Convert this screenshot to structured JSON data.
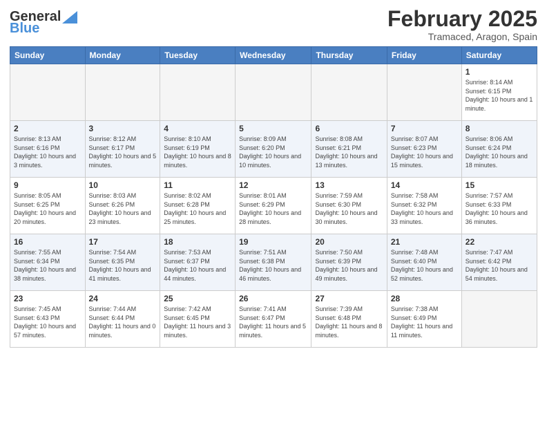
{
  "logo": {
    "general": "General",
    "blue": "Blue"
  },
  "header": {
    "month": "February 2025",
    "location": "Tramaced, Aragon, Spain"
  },
  "days_of_week": [
    "Sunday",
    "Monday",
    "Tuesday",
    "Wednesday",
    "Thursday",
    "Friday",
    "Saturday"
  ],
  "weeks": [
    [
      {
        "day": "",
        "info": ""
      },
      {
        "day": "",
        "info": ""
      },
      {
        "day": "",
        "info": ""
      },
      {
        "day": "",
        "info": ""
      },
      {
        "day": "",
        "info": ""
      },
      {
        "day": "",
        "info": ""
      },
      {
        "day": "1",
        "info": "Sunrise: 8:14 AM\nSunset: 6:15 PM\nDaylight: 10 hours and 1 minute."
      }
    ],
    [
      {
        "day": "2",
        "info": "Sunrise: 8:13 AM\nSunset: 6:16 PM\nDaylight: 10 hours and 3 minutes."
      },
      {
        "day": "3",
        "info": "Sunrise: 8:12 AM\nSunset: 6:17 PM\nDaylight: 10 hours and 5 minutes."
      },
      {
        "day": "4",
        "info": "Sunrise: 8:10 AM\nSunset: 6:19 PM\nDaylight: 10 hours and 8 minutes."
      },
      {
        "day": "5",
        "info": "Sunrise: 8:09 AM\nSunset: 6:20 PM\nDaylight: 10 hours and 10 minutes."
      },
      {
        "day": "6",
        "info": "Sunrise: 8:08 AM\nSunset: 6:21 PM\nDaylight: 10 hours and 13 minutes."
      },
      {
        "day": "7",
        "info": "Sunrise: 8:07 AM\nSunset: 6:23 PM\nDaylight: 10 hours and 15 minutes."
      },
      {
        "day": "8",
        "info": "Sunrise: 8:06 AM\nSunset: 6:24 PM\nDaylight: 10 hours and 18 minutes."
      }
    ],
    [
      {
        "day": "9",
        "info": "Sunrise: 8:05 AM\nSunset: 6:25 PM\nDaylight: 10 hours and 20 minutes."
      },
      {
        "day": "10",
        "info": "Sunrise: 8:03 AM\nSunset: 6:26 PM\nDaylight: 10 hours and 23 minutes."
      },
      {
        "day": "11",
        "info": "Sunrise: 8:02 AM\nSunset: 6:28 PM\nDaylight: 10 hours and 25 minutes."
      },
      {
        "day": "12",
        "info": "Sunrise: 8:01 AM\nSunset: 6:29 PM\nDaylight: 10 hours and 28 minutes."
      },
      {
        "day": "13",
        "info": "Sunrise: 7:59 AM\nSunset: 6:30 PM\nDaylight: 10 hours and 30 minutes."
      },
      {
        "day": "14",
        "info": "Sunrise: 7:58 AM\nSunset: 6:32 PM\nDaylight: 10 hours and 33 minutes."
      },
      {
        "day": "15",
        "info": "Sunrise: 7:57 AM\nSunset: 6:33 PM\nDaylight: 10 hours and 36 minutes."
      }
    ],
    [
      {
        "day": "16",
        "info": "Sunrise: 7:55 AM\nSunset: 6:34 PM\nDaylight: 10 hours and 38 minutes."
      },
      {
        "day": "17",
        "info": "Sunrise: 7:54 AM\nSunset: 6:35 PM\nDaylight: 10 hours and 41 minutes."
      },
      {
        "day": "18",
        "info": "Sunrise: 7:53 AM\nSunset: 6:37 PM\nDaylight: 10 hours and 44 minutes."
      },
      {
        "day": "19",
        "info": "Sunrise: 7:51 AM\nSunset: 6:38 PM\nDaylight: 10 hours and 46 minutes."
      },
      {
        "day": "20",
        "info": "Sunrise: 7:50 AM\nSunset: 6:39 PM\nDaylight: 10 hours and 49 minutes."
      },
      {
        "day": "21",
        "info": "Sunrise: 7:48 AM\nSunset: 6:40 PM\nDaylight: 10 hours and 52 minutes."
      },
      {
        "day": "22",
        "info": "Sunrise: 7:47 AM\nSunset: 6:42 PM\nDaylight: 10 hours and 54 minutes."
      }
    ],
    [
      {
        "day": "23",
        "info": "Sunrise: 7:45 AM\nSunset: 6:43 PM\nDaylight: 10 hours and 57 minutes."
      },
      {
        "day": "24",
        "info": "Sunrise: 7:44 AM\nSunset: 6:44 PM\nDaylight: 11 hours and 0 minutes."
      },
      {
        "day": "25",
        "info": "Sunrise: 7:42 AM\nSunset: 6:45 PM\nDaylight: 11 hours and 3 minutes."
      },
      {
        "day": "26",
        "info": "Sunrise: 7:41 AM\nSunset: 6:47 PM\nDaylight: 11 hours and 5 minutes."
      },
      {
        "day": "27",
        "info": "Sunrise: 7:39 AM\nSunset: 6:48 PM\nDaylight: 11 hours and 8 minutes."
      },
      {
        "day": "28",
        "info": "Sunrise: 7:38 AM\nSunset: 6:49 PM\nDaylight: 11 hours and 11 minutes."
      },
      {
        "day": "",
        "info": ""
      }
    ]
  ]
}
